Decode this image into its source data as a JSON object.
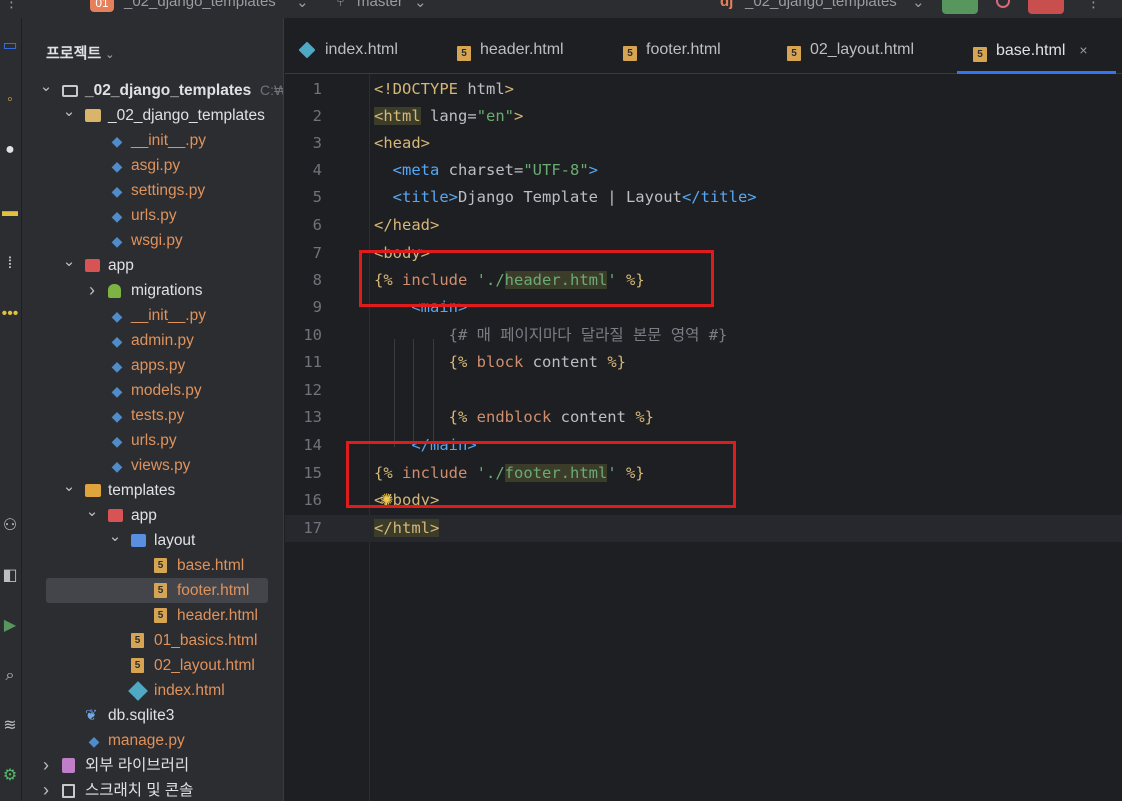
{
  "topbar": {
    "project_badge": "01",
    "project_name": "_02_django_templates",
    "branch": "master",
    "run_config": "_02_django_templates"
  },
  "sidebar": {
    "title": "프로젝트"
  },
  "tree": [
    {
      "label": "_02_django_templates",
      "suffix": "C:₩",
      "depth": 0,
      "arrow": "down",
      "icon": "folder"
    },
    {
      "label": "_02_django_templates",
      "depth": 1,
      "arrow": "down",
      "icon": "folder-yellow"
    },
    {
      "label": "__init__.py",
      "depth": 2,
      "icon": "python"
    },
    {
      "label": "asgi.py",
      "depth": 2,
      "icon": "python"
    },
    {
      "label": "settings.py",
      "depth": 2,
      "icon": "python"
    },
    {
      "label": "urls.py",
      "depth": 2,
      "icon": "python"
    },
    {
      "label": "wsgi.py",
      "depth": 2,
      "icon": "python"
    },
    {
      "label": "app",
      "depth": 1,
      "arrow": "down",
      "icon": "grid"
    },
    {
      "label": "migrations",
      "depth": 2,
      "arrow": "right",
      "icon": "migrations"
    },
    {
      "label": "__init__.py",
      "depth": 2,
      "icon": "python"
    },
    {
      "label": "admin.py",
      "depth": 2,
      "icon": "python"
    },
    {
      "label": "apps.py",
      "depth": 2,
      "icon": "python"
    },
    {
      "label": "models.py",
      "depth": 2,
      "icon": "python"
    },
    {
      "label": "tests.py",
      "depth": 2,
      "icon": "python"
    },
    {
      "label": "urls.py",
      "depth": 2,
      "icon": "python"
    },
    {
      "label": "views.py",
      "depth": 2,
      "icon": "python"
    },
    {
      "label": "templates",
      "depth": 1,
      "arrow": "down",
      "icon": "folder-template"
    },
    {
      "label": "app",
      "depth": 2,
      "arrow": "down",
      "icon": "grid"
    },
    {
      "label": "layout",
      "depth": 3,
      "arrow": "down",
      "icon": "grid-blue"
    },
    {
      "label": "base.html",
      "depth": 4,
      "icon": "html5"
    },
    {
      "label": "footer.html",
      "depth": 4,
      "icon": "html5",
      "selected": true
    },
    {
      "label": "header.html",
      "depth": 4,
      "icon": "html5"
    },
    {
      "label": "01_basics.html",
      "depth": 3,
      "icon": "html5"
    },
    {
      "label": "02_layout.html",
      "depth": 3,
      "icon": "html5"
    },
    {
      "label": "index.html",
      "depth": 3,
      "icon": "django"
    },
    {
      "label": "db.sqlite3",
      "depth": 1,
      "icon": "feather"
    },
    {
      "label": "manage.py",
      "depth": 1,
      "icon": "python"
    },
    {
      "label": "외부 라이브러리",
      "depth": 0,
      "arrow": "right",
      "icon": "library"
    },
    {
      "label": "스크래치 및 콘솔",
      "depth": 0,
      "arrow": "right",
      "icon": "scratch"
    }
  ],
  "tabs": [
    {
      "label": "index.html",
      "icon": "django"
    },
    {
      "label": "header.html",
      "icon": "html5"
    },
    {
      "label": "footer.html",
      "icon": "html5"
    },
    {
      "label": "02_layout.html",
      "icon": "html5"
    },
    {
      "label": "base.html",
      "icon": "html5",
      "active": true,
      "close": "×"
    }
  ],
  "code_lines": [
    {
      "n": "1"
    },
    {
      "n": "2"
    },
    {
      "n": "3"
    },
    {
      "n": "4"
    },
    {
      "n": "5"
    },
    {
      "n": "6"
    },
    {
      "n": "7"
    },
    {
      "n": "8"
    },
    {
      "n": "9"
    },
    {
      "n": "10"
    },
    {
      "n": "11"
    },
    {
      "n": "12"
    },
    {
      "n": "13"
    },
    {
      "n": "14"
    },
    {
      "n": "15"
    },
    {
      "n": "16"
    },
    {
      "n": "17"
    }
  ],
  "code": {
    "l1_a": "<!DOCTYPE ",
    "l1_b": "html",
    "l1_c": ">",
    "l2_a": "<",
    "l2_b": "html",
    "l2_c": " lang",
    "l2_d": "=",
    "l2_e": "\"en\"",
    "l2_f": ">",
    "l3": "<head>",
    "l4_a": "<meta",
    "l4_b": " charset",
    "l4_c": "=",
    "l4_d": "\"UTF-8\"",
    "l4_e": ">",
    "l5_a": "<title>",
    "l5_b": "Django Template | Layout",
    "l5_c": "</title>",
    "l6": "</head>",
    "l7": "<body>",
    "l8_a": "{% ",
    "l8_b": "include",
    "l8_c": " '",
    "l8_d": "./",
    "l8_e": "header.html",
    "l8_f": "'",
    "l8_g": " %}",
    "l9": "<main>",
    "l10": "{# 매 페이지마다 달라질 본문 영역 #}",
    "l11_a": "{% ",
    "l11_b": "block",
    "l11_c": " content ",
    "l11_d": "%}",
    "l13_a": "{% ",
    "l13_b": "endblock",
    "l13_c": " content ",
    "l13_d": "%}",
    "l14": "</main>",
    "l15_a": "{% ",
    "l15_b": "include",
    "l15_c": " '",
    "l15_d": "./",
    "l15_e": "footer.html",
    "l15_f": "'",
    "l15_g": " %}",
    "l16": "</body>",
    "l17": "</html>"
  },
  "colors": {
    "accent": "#3574f0",
    "annotation": "#e01b1b"
  }
}
